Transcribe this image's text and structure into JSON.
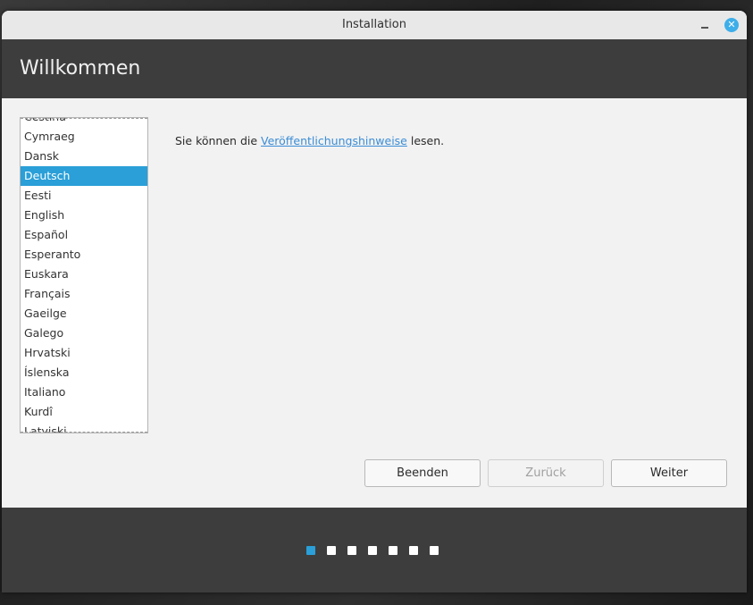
{
  "window": {
    "title": "Installation"
  },
  "page": {
    "title": "Willkommen"
  },
  "languages": {
    "items": [
      "Čeština",
      "Cymraeg",
      "Dansk",
      "Deutsch",
      "Eesti",
      "English",
      "Español",
      "Esperanto",
      "Euskara",
      "Français",
      "Gaeilge",
      "Galego",
      "Hrvatski",
      "Íslenska",
      "Italiano",
      "Kurdî",
      "Latviski"
    ],
    "selected": "Deutsch"
  },
  "notes": {
    "prefix": "Sie können die ",
    "link": "Veröffentlichungshinweise",
    "suffix": " lesen."
  },
  "buttons": {
    "quit": "Beenden",
    "back": "Zurück",
    "next": "Weiter"
  },
  "progress": {
    "total_steps": 7,
    "current_step": 1
  },
  "colors": {
    "accent": "#2a9fd8",
    "header": "#3d3d3d",
    "link": "#3b8dd6"
  }
}
